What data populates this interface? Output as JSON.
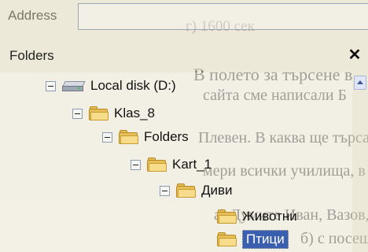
{
  "address_bar": {
    "label": "Address",
    "value": ""
  },
  "folders_pane": {
    "title": "Folders",
    "close_glyph": "✕"
  },
  "tree": [
    {
      "label": "Local disk (D:)",
      "icon": "drive-icon",
      "expanded": true,
      "depth": 0
    },
    {
      "label": "Klas_8",
      "icon": "folder-icon",
      "expanded": true,
      "depth": 1
    },
    {
      "label": "Folders",
      "icon": "folder-icon",
      "expanded": true,
      "depth": 2
    },
    {
      "label": "Kart_1",
      "icon": "folder-icon",
      "expanded": true,
      "depth": 3
    },
    {
      "label": "Диви",
      "icon": "folder-icon",
      "expanded": true,
      "depth": 4
    },
    {
      "label": "Животни",
      "icon": "folder-icon",
      "expanded": false,
      "depth": 5
    },
    {
      "label": "Птици",
      "icon": "folder-icon",
      "expanded": false,
      "depth": 5,
      "selected": true
    }
  ],
  "background_text": [
    "г) 1600 сек",
    "В полето за търсене в",
    "сайта сме написали Б",
    "Плевен. В каква ще търсаи",
    "мери всички училища, в кой",
    "а) Думите Иван, Вазов, СОУ в",
    "б) с посещението Иван В"
  ],
  "colors": {
    "selection": "#3a5fae",
    "folder": "#e6bf5a",
    "page_bg": "#ece9d8"
  }
}
